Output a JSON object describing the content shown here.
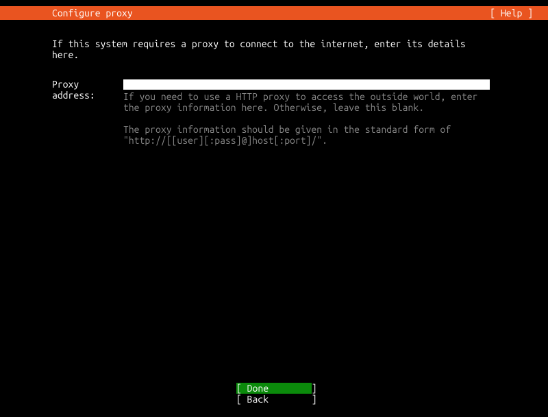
{
  "header": {
    "title": "Configure proxy",
    "help": "[ Help ]"
  },
  "instruction": "If this system requires a proxy to connect to the internet, enter its details here.",
  "form": {
    "label": "Proxy address:",
    "value": "",
    "help1": "If you need to use a HTTP proxy to access the outside world, enter the proxy information here. Otherwise, leave this blank.",
    "help2": "The proxy information should be given in the standard form of \"http://[[user][:pass]@]host[:port]/\"."
  },
  "footer": {
    "done": "[ Done        ]",
    "back": "[ Back        ]"
  }
}
